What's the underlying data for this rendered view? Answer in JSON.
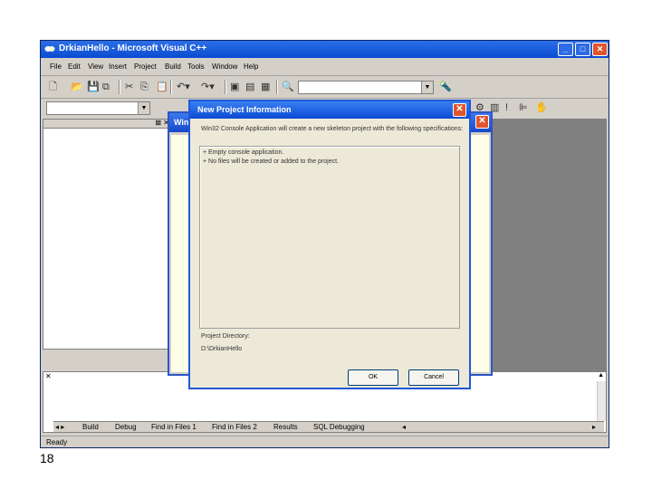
{
  "window": {
    "title": "DrkianHello - Microsoft Visual C++",
    "minimize": "_",
    "maximize": "□",
    "close": "✕"
  },
  "menu": [
    "File",
    "Edit",
    "View",
    "Insert",
    "Project",
    "Build",
    "Tools",
    "Window",
    "Help"
  ],
  "toolbar": {
    "find_combo_value": ""
  },
  "back_dialog": {
    "title": "Win",
    "close": "✕"
  },
  "dialog": {
    "title": "New Project Information",
    "close": "✕",
    "description": "Win32 Console Application will create a new skeleton project with the following specifications:",
    "spec_lines": [
      "+ Empty console application.",
      "+ No files will be created or added to the project."
    ],
    "directory_label": "Project Directory:",
    "directory_value": "D:\\DrkianHello",
    "ok_label": "OK",
    "cancel_label": "Cancel"
  },
  "output_tabs": [
    "Build",
    "Debug",
    "Find in Files 1",
    "Find in Files 2",
    "Results",
    "SQL Debugging"
  ],
  "status": "Ready",
  "page_number": "18"
}
